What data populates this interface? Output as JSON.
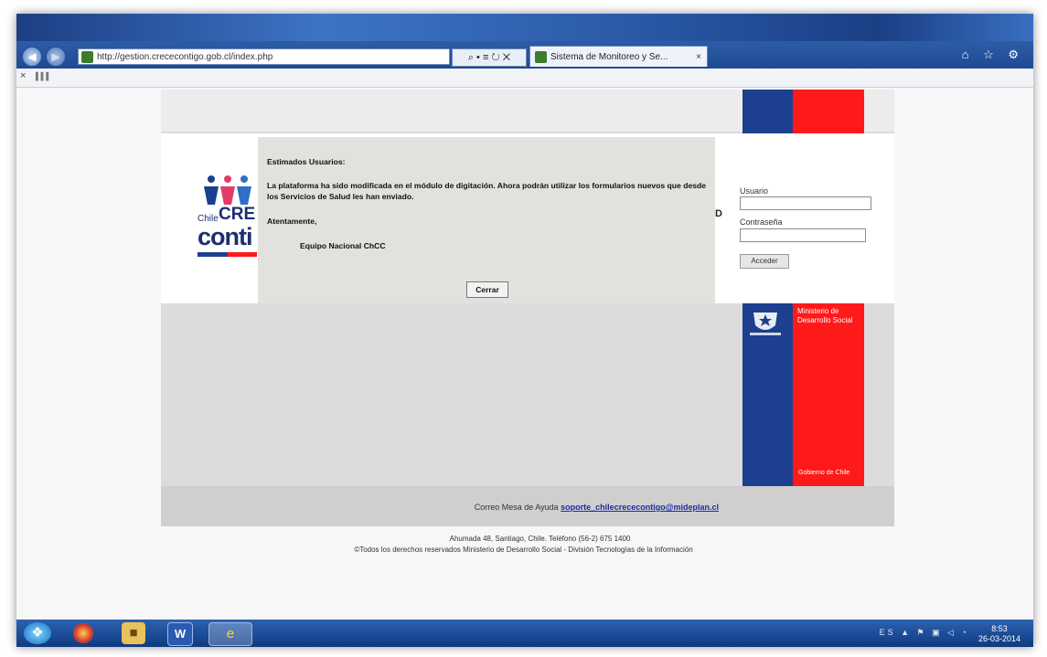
{
  "browser": {
    "address": "http://gestion.crececontigo.gob.cl/index.php",
    "address_host_bold": "crececontigo.gob.cl",
    "address_tools": "⌕ • ≡ ↻ ✕",
    "tab_title": "Sistema de Monitoreo y Se...",
    "tab_close": "×",
    "right_icons": "⌂ ☆ ⚙",
    "cmd_close": "×",
    "cmd_signal": "▐▐▐"
  },
  "modal": {
    "greeting": "Estimados Usuarios:",
    "message": "La plataforma ha sido modificada en el módulo de digitación. Ahora podrán utilizar los formularios nuevos que desde los Servicios de Salud les han enviado.",
    "regards": "Atentamente,",
    "team": "Equipo Nacional ChCC",
    "close_label": "Cerrar"
  },
  "logo": {
    "chile": "Chile",
    "cre": "CRE",
    "conti": "conti"
  },
  "login": {
    "user_label": "Usuario",
    "password_label": "Contraseña",
    "submit_label": "Acceder",
    "stray": "D"
  },
  "ministry": {
    "name": "Ministerio de Desarrollo Social",
    "government": "Gobierno de Chile"
  },
  "footer": {
    "help_prefix": "Correo Mesa de Ayuda",
    "help_email": "soporte_chilecrececontigo@mideplan.cl"
  },
  "below_page": {
    "address_line": "Ahumada 48, Santiago, Chile. Teléfono (56-2) 675 1400",
    "rights_line": "©Todos los derechos reservados Ministerio de Desarrollo Social - División Tecnologías de la Información"
  },
  "taskbar": {
    "tray": "ES ▲ ⚑ ▣ ◁ ◔",
    "time": "8:53",
    "date": "26-03-2014"
  },
  "colors": {
    "chile_blue": "#1c3f8f",
    "chile_red": "#ff1a1a",
    "modal_bg": "#e3e1de"
  }
}
